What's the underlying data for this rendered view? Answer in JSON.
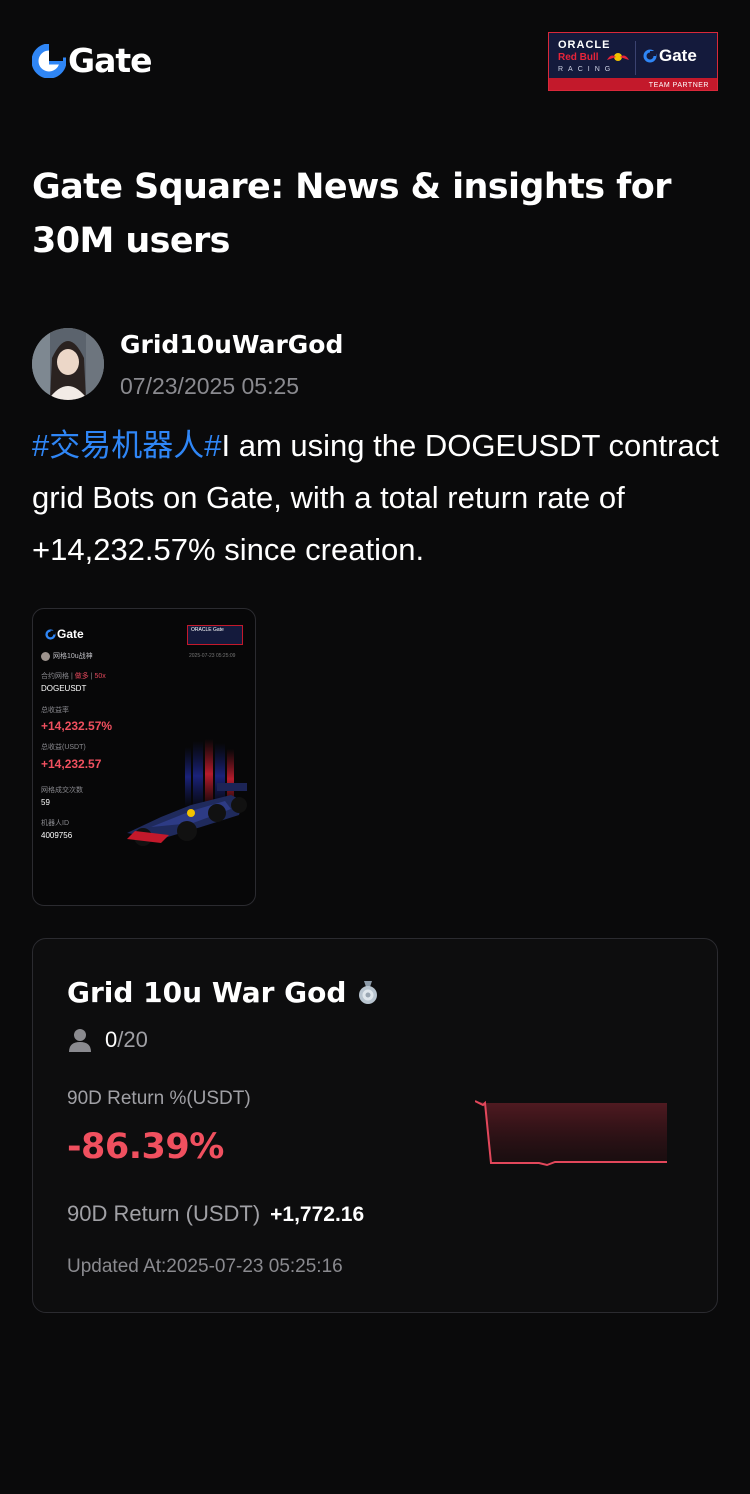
{
  "header": {
    "logo_text": "Gate",
    "partner": {
      "oracle": "ORACLE",
      "redbull": "Red Bull",
      "racing": "RACING",
      "gate": "Gate",
      "team_partner": "TEAM PARTNER"
    }
  },
  "headline": "Gate Square: News & insights for 30M users",
  "post": {
    "author": "Grid10uWarGod",
    "time": "07/23/2025 05:25",
    "hashtag": "#交易机器人#",
    "text": "I am using the DOGEUSDT contract grid Bots on Gate, with a total return rate of +14,232.57% since creation."
  },
  "image_card": {
    "logo_text": "Gate",
    "partner_text": "ORACLE Gate",
    "user": "网格10u战神",
    "date": "2025-07-23 05:25:09",
    "tag1": "合约网格",
    "tag2": "做多",
    "tag3": "50x",
    "pair": "DOGEUSDT",
    "ret_rate_label": "总收益率",
    "ret_rate": "+14,232.57%",
    "ret_amt_label": "总收益(USDT)",
    "ret_amt": "+14,232.57",
    "trades_label": "网格成交次数",
    "trades": "59",
    "bot_id_label": "机器人ID",
    "bot_id": "4009756"
  },
  "bot_card": {
    "name": "Grid 10u War God",
    "followers_current": "0",
    "followers_max": "/20",
    "return_pct_label": "90D Return %(USDT)",
    "return_pct": "-86.39%",
    "return_usdt_label": "90D Return (USDT)",
    "return_usdt": "+1,772.16",
    "updated": "Updated At:2025-07-23 05:25:16"
  },
  "colors": {
    "background": "#0a0a0b",
    "brand_blue": "#2f86f6",
    "negative_red": "#f0505f",
    "muted_text": "#8a8a8f"
  },
  "icons": {
    "logo": "gate-logo-icon",
    "followers": "user-icon",
    "badge": "medal-icon"
  }
}
